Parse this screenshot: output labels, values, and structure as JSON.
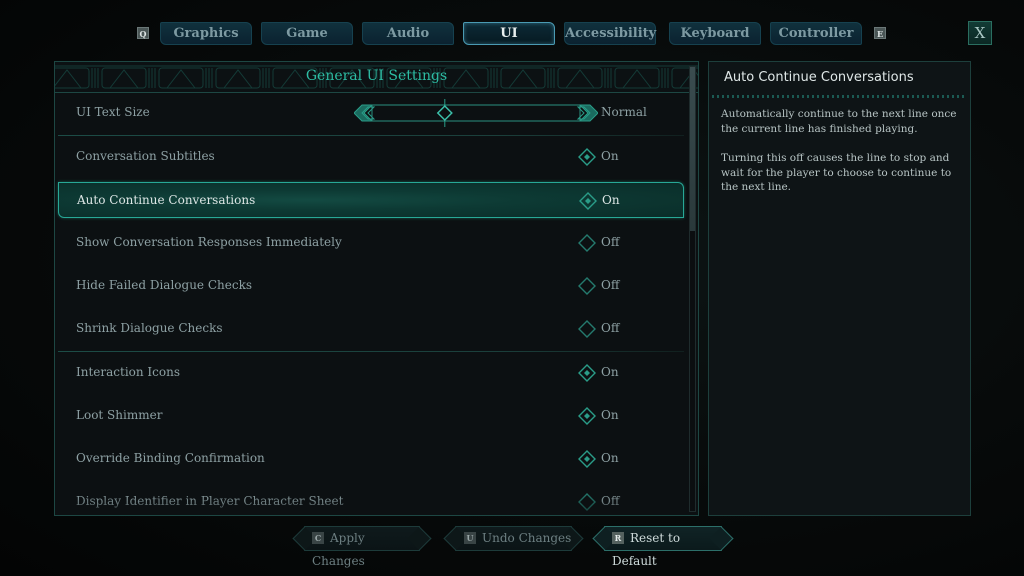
{
  "tabs": {
    "prev_key": "Q",
    "next_key": "E",
    "items": [
      {
        "label": "Graphics",
        "active": false
      },
      {
        "label": "Game",
        "active": false
      },
      {
        "label": "Audio",
        "active": false
      },
      {
        "label": "UI",
        "active": true
      },
      {
        "label": "Accessibility",
        "active": false
      },
      {
        "label": "Keyboard",
        "active": false
      },
      {
        "label": "Controller",
        "active": false
      }
    ],
    "close_label": "X"
  },
  "settings": {
    "section_title": "General UI Settings",
    "rows": [
      {
        "label": "UI Text Size",
        "type": "slider",
        "value": "Normal",
        "slider_fraction": 0.35
      },
      {
        "label": "Conversation Subtitles",
        "type": "toggle",
        "value": "On",
        "on": true
      },
      {
        "label": "Auto Continue Conversations",
        "type": "toggle",
        "value": "On",
        "on": true,
        "selected": true
      },
      {
        "label": "Show Conversation Responses Immediately",
        "type": "toggle",
        "value": "Off",
        "on": false
      },
      {
        "label": "Hide Failed Dialogue Checks",
        "type": "toggle",
        "value": "Off",
        "on": false
      },
      {
        "label": "Shrink Dialogue Checks",
        "type": "toggle",
        "value": "Off",
        "on": false
      },
      {
        "label": "Interaction Icons",
        "type": "toggle",
        "value": "On",
        "on": true
      },
      {
        "label": "Loot Shimmer",
        "type": "toggle",
        "value": "On",
        "on": true
      },
      {
        "label": "Override Binding Confirmation",
        "type": "toggle",
        "value": "On",
        "on": true
      },
      {
        "label": "Display Identifier in Player Character Sheet",
        "type": "toggle",
        "value": "Off",
        "on": false
      }
    ],
    "scroll_fraction_visible": 0.37
  },
  "description": {
    "title": "Auto Continue Conversations",
    "paragraphs": [
      "Automatically continue to the next line once the current line has finished playing.",
      "Turning this off causes the line to stop and wait for the player to choose to continue to the next line."
    ]
  },
  "actions": [
    {
      "key": "C",
      "label": "Apply Changes",
      "enabled": false
    },
    {
      "key": "U",
      "label": "Undo Changes",
      "enabled": false
    },
    {
      "key": "R",
      "label": "Reset to Default",
      "enabled": true
    }
  ],
  "colors": {
    "accent": "#2dbca3",
    "selected_row": "#0d3a34",
    "tab_active_border": "#4a9ab2"
  }
}
